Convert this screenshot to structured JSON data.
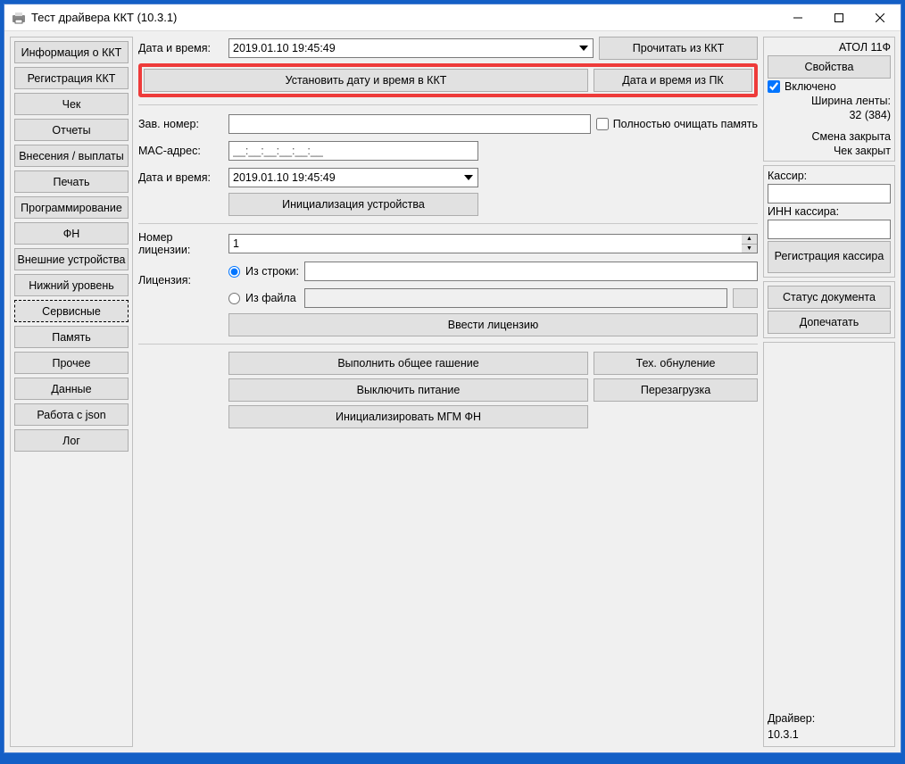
{
  "window": {
    "title": "Тест драйвера ККТ (10.3.1)"
  },
  "sidebar": [
    "Информация о ККТ",
    "Регистрация ККТ",
    "Чек",
    "Отчеты",
    "Внесения / выплаты",
    "Печать",
    "Программирование",
    "ФН",
    "Внешние устройства",
    "Нижний уровень",
    "Сервисные",
    "Память",
    "Прочее",
    "Данные",
    "Работа с json",
    "Лог"
  ],
  "sidebar_selected_index": 10,
  "main": {
    "date_label": "Дата и время:",
    "date_value": "2019.01.10 19:45:49",
    "read_kkt": "Прочитать из ККТ",
    "set_dt_kkt": "Установить дату и время в ККТ",
    "dt_from_pc": "Дата и время из ПК",
    "serial_label": "Зав. номер:",
    "serial_value": "",
    "full_clear": "Полностью очищать память",
    "mac_label": "MAC-адрес:",
    "mac_value": "__:__:__:__:__:__",
    "dt2_label": "Дата и время:",
    "dt2_value": "2019.01.10 19:45:49",
    "init_device": "Инициализация устройства",
    "lic_num_label": "Номер лицензии:",
    "lic_num_value": "1",
    "lic_label": "Лицензия:",
    "from_string": "Из строки:",
    "from_file": "Из файла",
    "enter_license": "Ввести лицензию",
    "do_blanking": "Выполнить общее гашение",
    "tech_reset": "Тех. обнуление",
    "power_off": "Выключить питание",
    "reboot": "Перезагрузка",
    "init_mgm": "Инициализировать МГМ ФН"
  },
  "right": {
    "model": "АТОЛ 11Ф",
    "props_btn": "Свойства",
    "enabled": "Включено",
    "tape_width_l1": "Ширина ленты:",
    "tape_width_l2": "32 (384)",
    "shift": "Смена закрыта",
    "check": "Чек закрыт",
    "cashier_label": "Кассир:",
    "cashier_value": "",
    "inn_label": "ИНН кассира:",
    "inn_value": "",
    "reg_cashier": "Регистрация кассира",
    "doc_status": "Статус документа",
    "doprint": "Допечатать",
    "driver_label": "Драйвер:",
    "driver_ver": "10.3.1"
  }
}
